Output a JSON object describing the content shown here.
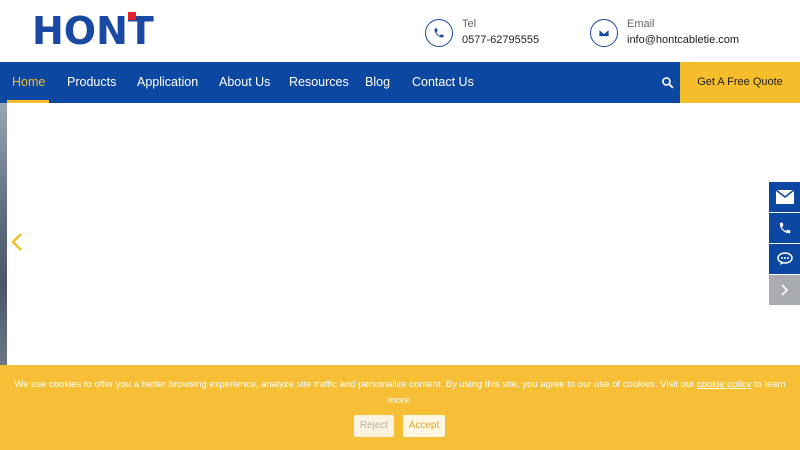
{
  "header": {
    "logo_text": "HONT",
    "tel_label": "Tel",
    "tel_value": "0577-62795555",
    "email_label": "Email",
    "email_value": "info@hontcabletie.com"
  },
  "nav": {
    "items": [
      {
        "label": "Home",
        "active": true
      },
      {
        "label": "Products",
        "active": false
      },
      {
        "label": "Application",
        "active": false
      },
      {
        "label": "About Us",
        "active": false
      },
      {
        "label": "Resources",
        "active": false
      },
      {
        "label": "Blog",
        "active": false
      },
      {
        "label": "Contact Us",
        "active": false
      }
    ],
    "quote_label": "Get A Free Quote"
  },
  "floating": [
    "envelope-icon",
    "phone-icon",
    "chat-icon",
    "chevron-right-icon"
  ],
  "cookie": {
    "text_before": "We use cookies to offer you a better browsing experience, analyze site traffic and personalize content. By using this site, you agree to our use of cookies. Visit our ",
    "link_text": "cookie policy",
    "text_after": " to learn more.",
    "reject_label": "Reject",
    "accept_label": "Accept"
  },
  "colors": {
    "brand_blue": "#0c47a1",
    "accent_yellow": "#f6bd2b",
    "logo_red": "#e3232b"
  }
}
